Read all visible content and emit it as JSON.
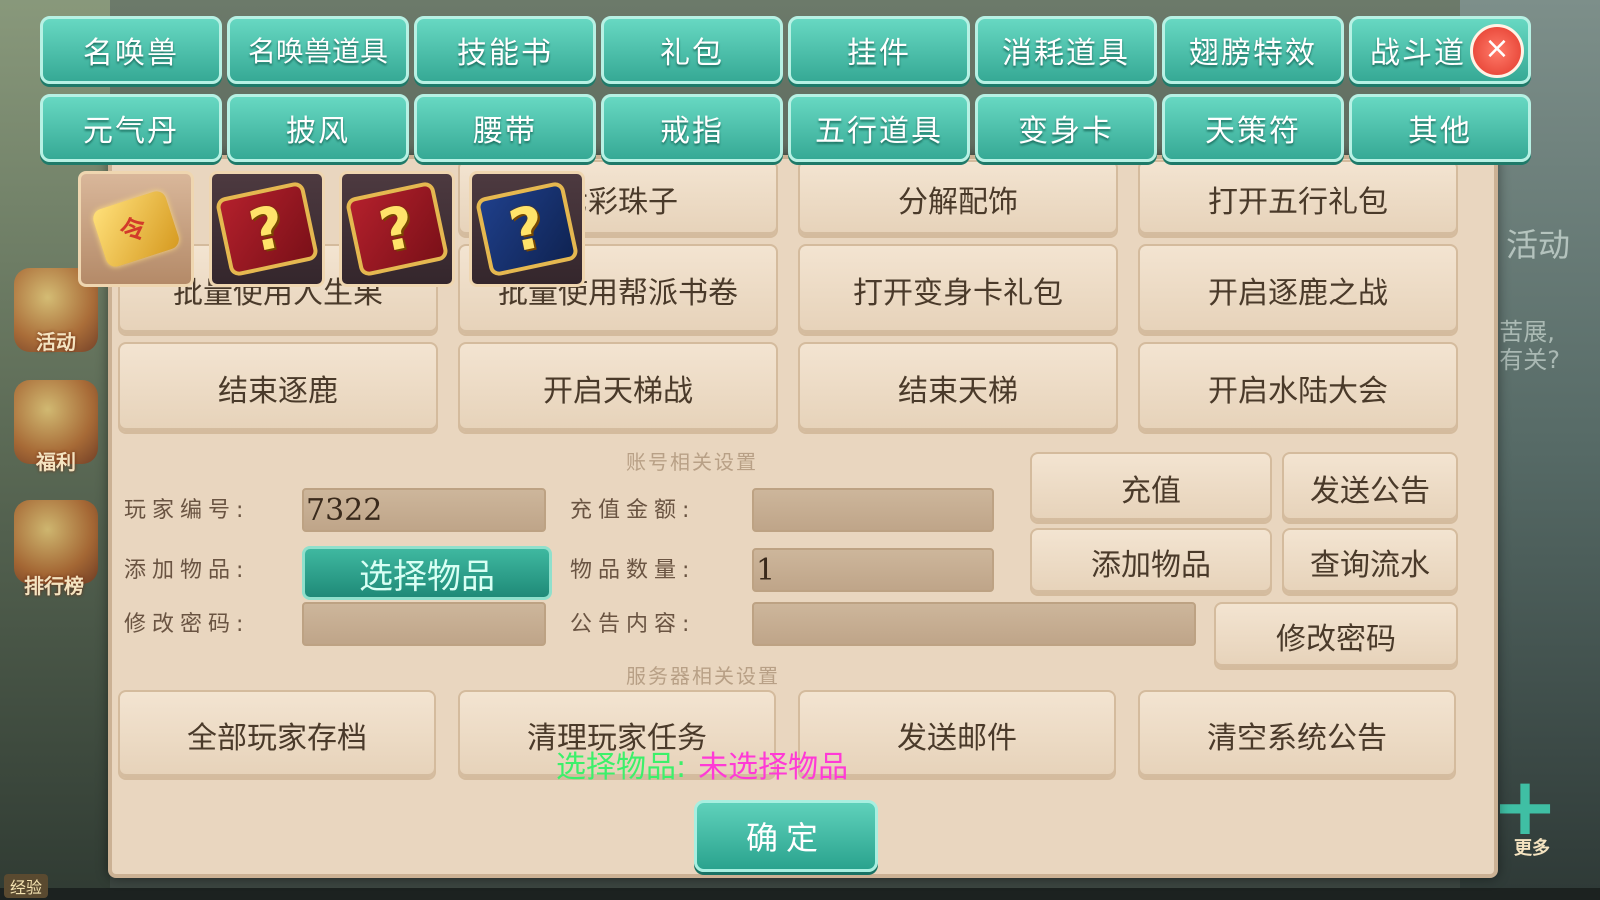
{
  "category_tabs": {
    "row1": [
      "名唤兽",
      "名唤兽道具",
      "技能书",
      "礼包",
      "挂件",
      "消耗道具",
      "翅膀特效",
      "战斗道"
    ],
    "row2": [
      "元气丹",
      "披风",
      "腰带",
      "戒指",
      "五行道具",
      "变身卡",
      "天策符",
      "其他"
    ]
  },
  "close_icon": "×",
  "item_slots": [
    {
      "icon": "scroll-icon",
      "selected": true
    },
    {
      "icon": "mystery-book-red-icon",
      "glyph": "?"
    },
    {
      "icon": "mystery-book-red-icon",
      "glyph": "?"
    },
    {
      "icon": "mystery-book-blue-icon",
      "glyph": "?"
    }
  ],
  "command_buttons": {
    "r1": [
      "七彩珠子",
      "分解配饰",
      "打开五行礼包"
    ],
    "r2": [
      "批量使用人生果",
      "批量使用帮派书卷",
      "打开变身卡礼包",
      "开启逐鹿之战"
    ],
    "r3": [
      "结束逐鹿",
      "开启天梯战",
      "结束天梯",
      "开启水陆大会"
    ]
  },
  "account_section": {
    "title": "账号相关设置",
    "player_id_label": "玩家编号:",
    "player_id_value": "7322",
    "add_item_label": "添加物品:",
    "select_item_button": "选择物品",
    "change_password_label": "修改密码:",
    "recharge_amount_label": "充值金额:",
    "recharge_amount_value": "",
    "item_quantity_label": "物品数量:",
    "item_quantity_value": "1",
    "announcement_label": "公告内容:",
    "announcement_value": "",
    "buttons": {
      "recharge": "充值",
      "send_announcement": "发送公告",
      "add_item": "添加物品",
      "query_log": "查询流水",
      "change_password": "修改密码"
    }
  },
  "server_section": {
    "title": "服务器相关设置",
    "buttons": [
      "全部玩家存档",
      "清理玩家任务",
      "发送邮件",
      "清空系统公告"
    ]
  },
  "status": {
    "label": "选择物品:",
    "value": "未选择物品"
  },
  "confirm_button": "确定",
  "background": {
    "side_labels": [
      "活动",
      "福利",
      "排行榜"
    ],
    "right_activity": "活动",
    "right_text": [
      "苦展,",
      "有关?"
    ],
    "more_label": "更多",
    "exp_label": "经验"
  },
  "colors": {
    "tab_teal": "#36a995",
    "panel_beige": "#e9d6bf",
    "status_green": "#3cf06a",
    "status_magenta": "#ff3ad6",
    "close_red": "#e2392b"
  }
}
